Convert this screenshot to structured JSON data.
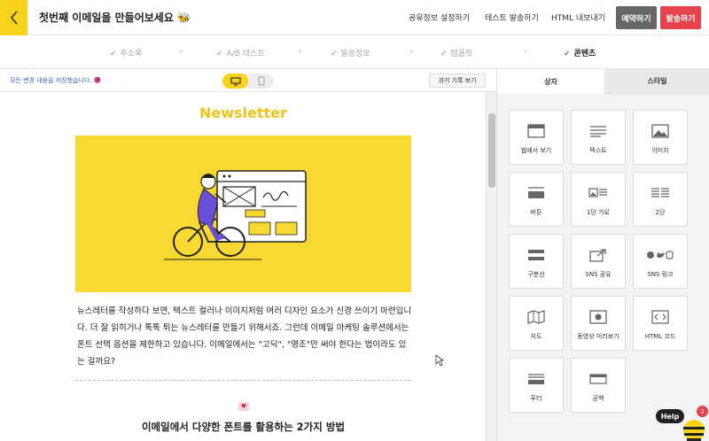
{
  "header": {
    "title": "첫번째 이메일을 만들어보세요",
    "title_emoji": "🐝",
    "links": [
      "공유정보 설정하기",
      "테스트 발송하기",
      "HTML 내보내기"
    ],
    "reserve_label": "예약하기",
    "send_label": "발송하기"
  },
  "steps": [
    {
      "label": "주소록",
      "done": true
    },
    {
      "label": "A/B 테스트",
      "done": true
    },
    {
      "label": "발송정보",
      "done": true
    },
    {
      "label": "템플릿",
      "done": true
    },
    {
      "label": "콘텐츠",
      "done": true,
      "active": true
    }
  ],
  "toolbar": {
    "saved_text": "모든 변경 내용을 저장했습니다. 🧶",
    "history_label": "과거 기록 보기"
  },
  "content": {
    "newsletter_title": "Newsletter",
    "body_text": "뉴스레터를 작성하다 보면, 텍스트 컬러나 이미지처럼 여러 디자인 요소가 신경 쓰이기 마련입니다. 더 잘 읽히거나 톡톡 튀는 뉴스레터를 만들기 위해서죠. 그런데 이메일 마케팅 솔루션에서는 폰트 선택 옵션을 제한하고 있습니다. 이메일에서는 \"고딕\", \"명조\"만 써야 한다는 법이라도 있는 걸까요?",
    "heading2": "이메일에서 다양한 폰트를 활용하는 2가지 방법"
  },
  "panel": {
    "tabs": [
      "상자",
      "스타일"
    ],
    "tiles": [
      {
        "label": "웹에서 보기",
        "icon": "browser-icon"
      },
      {
        "label": "텍스트",
        "icon": "text-lines-icon"
      },
      {
        "label": "이미지",
        "icon": "image-icon"
      },
      {
        "label": "버튼",
        "icon": "button-icon"
      },
      {
        "label": "1단 가로",
        "icon": "one-column-icon"
      },
      {
        "label": "2단",
        "icon": "two-column-icon"
      },
      {
        "label": "구분선",
        "icon": "divider-icon"
      },
      {
        "label": "SNS 공유",
        "icon": "share-icon"
      },
      {
        "label": "SNS 링크",
        "icon": "social-links-icon"
      },
      {
        "label": "지도",
        "icon": "map-icon"
      },
      {
        "label": "동영상 미리보기",
        "icon": "video-icon"
      },
      {
        "label": "HTML 코드",
        "icon": "code-icon"
      },
      {
        "label": "푸터",
        "icon": "footer-icon"
      },
      {
        "label": "공백",
        "icon": "spacer-icon"
      }
    ]
  },
  "help": {
    "label": "Help",
    "badge": "2"
  },
  "colors": {
    "brand_yellow": "#f7d31c",
    "reserve": "#666666",
    "send": "#e8424d",
    "link_blue": "#3a64c8"
  }
}
